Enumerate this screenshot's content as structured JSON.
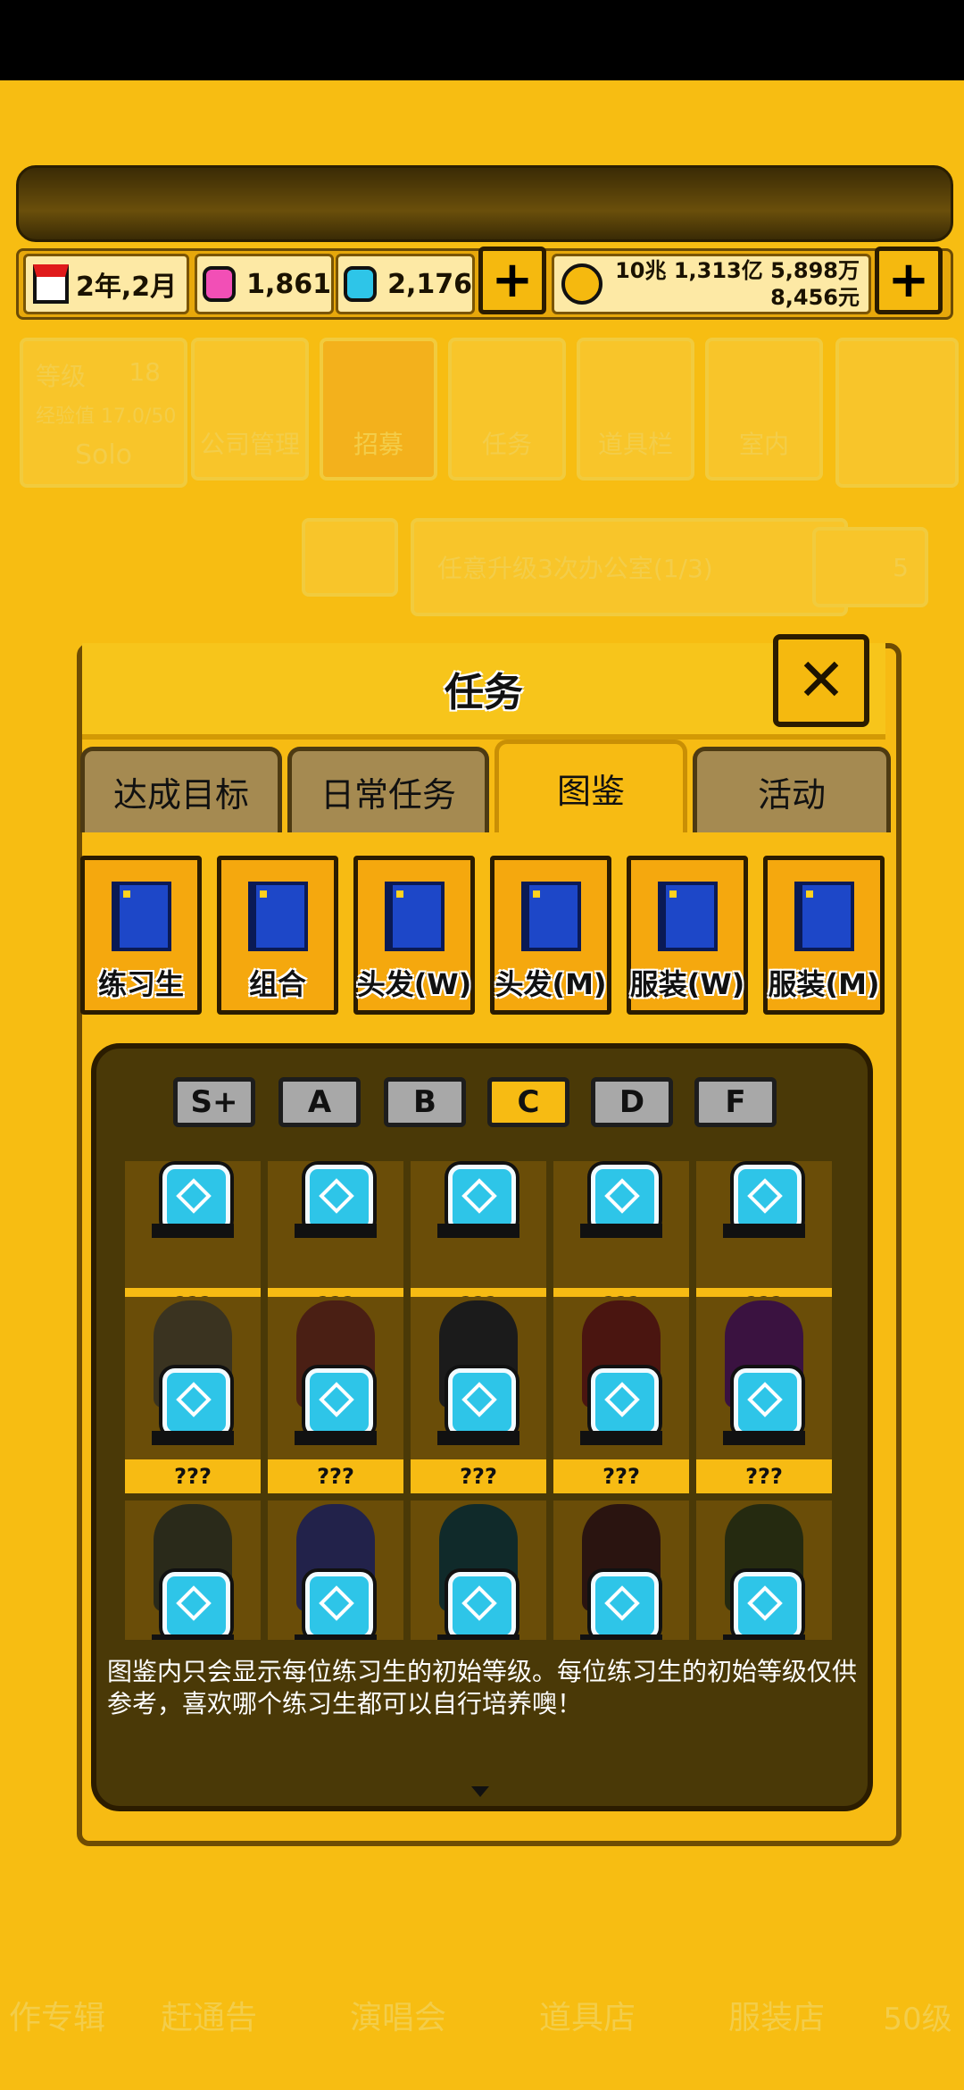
{
  "resources": {
    "date": "2年,2月",
    "pink_gems": "1,861",
    "blue_gems": "2,176",
    "money_line1": "10兆 1,313亿 5,898万",
    "money_line2": "8,456元",
    "plus_symbol": "+"
  },
  "background_ui": {
    "level_label": "等级",
    "level_value": "18",
    "exp_label": "经验值 17.0/50",
    "group_name": "Solo",
    "menu": [
      "公司管理",
      "招募",
      "任务",
      "道具栏",
      "室内"
    ],
    "quest_text": "任意升级3次办公室(1/3)",
    "quest_reward": "5",
    "bottom_nav": [
      "作专辑",
      "赶通告",
      "演唱会",
      "道具店",
      "服装店",
      "50级"
    ]
  },
  "dialog": {
    "title": "任务",
    "close_symbol": "✕",
    "tabs": [
      "达成目标",
      "日常任务",
      "图鉴",
      "活动"
    ],
    "active_tab": "图鉴",
    "categories": [
      "练习生",
      "组合",
      "头发(W)",
      "头发(M)",
      "服装(W)",
      "服装(M)"
    ],
    "grades": [
      "S+",
      "A",
      "B",
      "C",
      "D",
      "F"
    ],
    "active_grade": "C",
    "cards": [
      {
        "label": "???"
      },
      {
        "label": "???"
      },
      {
        "label": "???"
      },
      {
        "label": "???"
      },
      {
        "label": "???"
      },
      {
        "label": "???"
      },
      {
        "label": "???"
      },
      {
        "label": "???"
      },
      {
        "label": "???"
      },
      {
        "label": "???"
      },
      {
        "label": "???"
      },
      {
        "label": "???"
      },
      {
        "label": "???"
      },
      {
        "label": "???"
      },
      {
        "label": "???"
      }
    ],
    "hint": "图鉴内只会显示每位练习生的初始等级。每位练习生的初始等级仅供参考，喜欢哪个练习生都可以自行培养噢！"
  },
  "colors": {
    "accent": "#f7bb13",
    "dark": "#2b1c00",
    "panel": "#4a3907"
  }
}
